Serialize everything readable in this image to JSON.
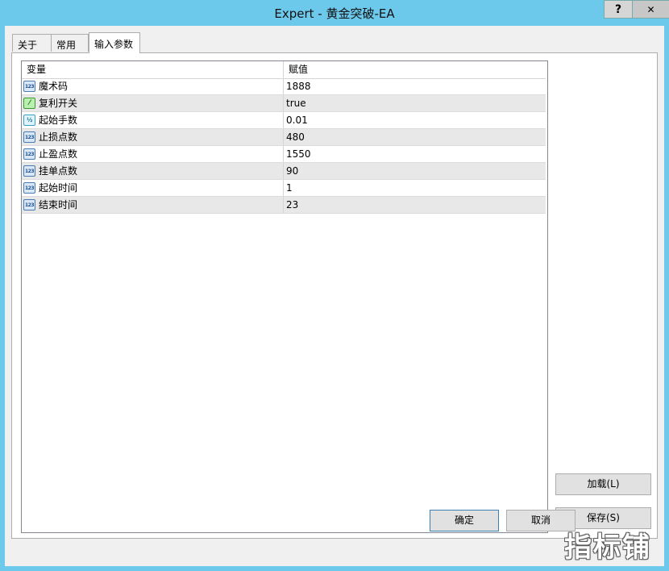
{
  "window": {
    "title": "Expert - 黄金突破-EA",
    "help_label": "?",
    "close_label": "✕"
  },
  "tabs": [
    {
      "label": "关于"
    },
    {
      "label": "常用"
    },
    {
      "label": "输入参数",
      "active": true
    }
  ],
  "grid": {
    "columns": [
      "变量",
      "赋值"
    ],
    "rows": [
      {
        "icon": "int-icon",
        "icon_text": "123",
        "name": "魔术码",
        "value": "1888"
      },
      {
        "icon": "bool-icon",
        "icon_text": "⁄",
        "name": "复利开关",
        "value": "true"
      },
      {
        "icon": "double-icon",
        "icon_text": "½",
        "name": "起始手数",
        "value": "0.01"
      },
      {
        "icon": "int-icon",
        "icon_text": "123",
        "name": "止损点数",
        "value": "480"
      },
      {
        "icon": "int-icon",
        "icon_text": "123",
        "name": "止盈点数",
        "value": "1550"
      },
      {
        "icon": "int-icon",
        "icon_text": "123",
        "name": "挂单点数",
        "value": "90"
      },
      {
        "icon": "int-icon",
        "icon_text": "123",
        "name": "起始时间",
        "value": "1"
      },
      {
        "icon": "int-icon",
        "icon_text": "123",
        "name": "结束时间",
        "value": "23"
      }
    ]
  },
  "buttons": {
    "load": "加载(L)",
    "save": "保存(S)",
    "ok": "确定",
    "cancel": "取消"
  },
  "watermark": "指标铺",
  "colors": {
    "titlebar": "#6dc9ec",
    "alt_row": "#e8e8e8",
    "ok_border": "#3c7fb1"
  }
}
